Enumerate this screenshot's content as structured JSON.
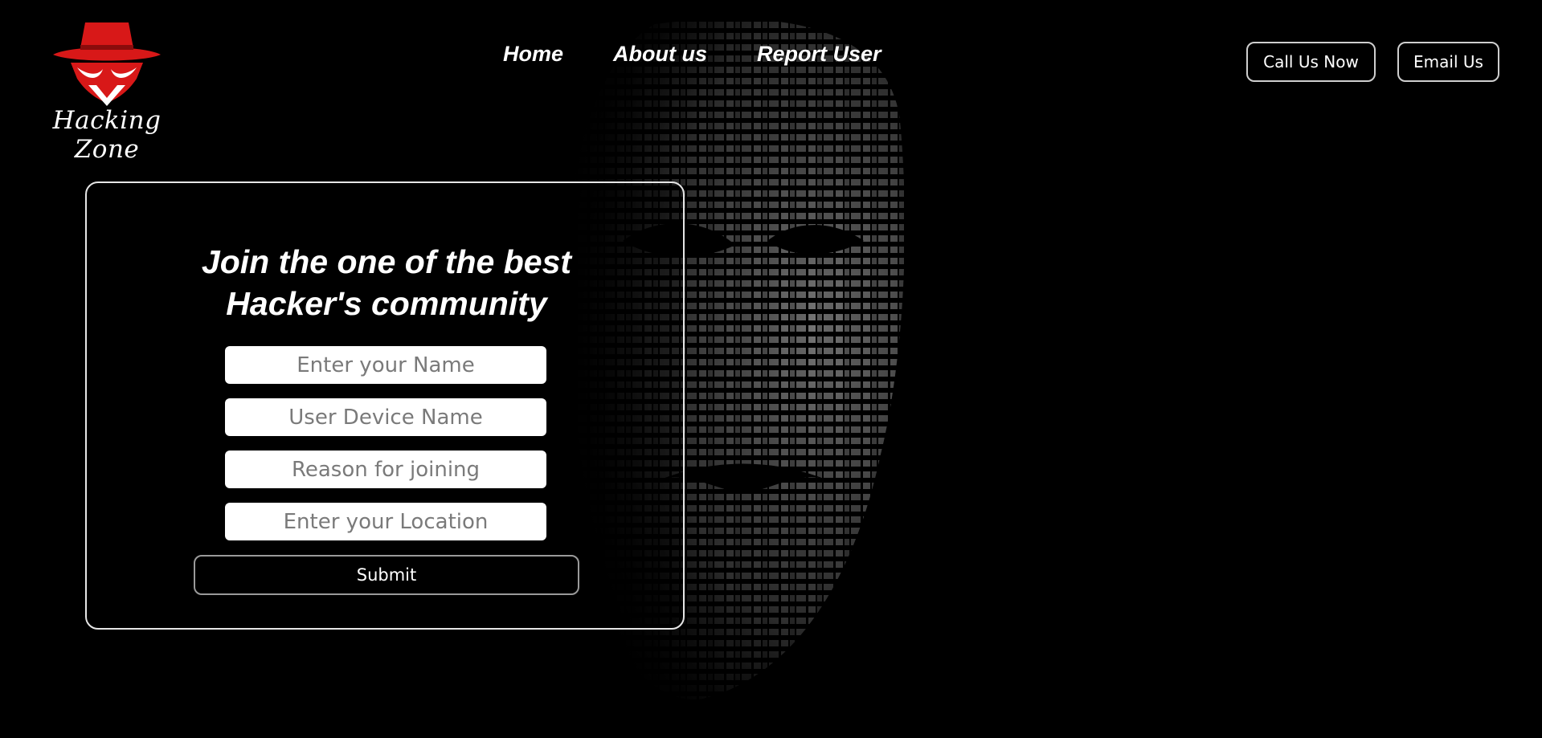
{
  "brand": {
    "name": "Hacking Zone",
    "logo_icon": "hat-spy-icon",
    "accent": "#e01b1b"
  },
  "nav": {
    "items": [
      {
        "label": "Home"
      },
      {
        "label": "About us"
      },
      {
        "label": "Report User"
      }
    ]
  },
  "header_buttons": {
    "call": "Call Us Now",
    "email": "Email Us"
  },
  "form": {
    "title_line1": "Join the one of the best",
    "title_line2": "Hacker's community",
    "fields": [
      {
        "placeholder": "Enter your Name",
        "value": ""
      },
      {
        "placeholder": "User Device Name",
        "value": ""
      },
      {
        "placeholder": "Reason for joining",
        "value": ""
      },
      {
        "placeholder": "Enter your Location",
        "value": ""
      }
    ],
    "submit_label": "Submit"
  },
  "background": {
    "image": "anonymous-mask-typography"
  }
}
